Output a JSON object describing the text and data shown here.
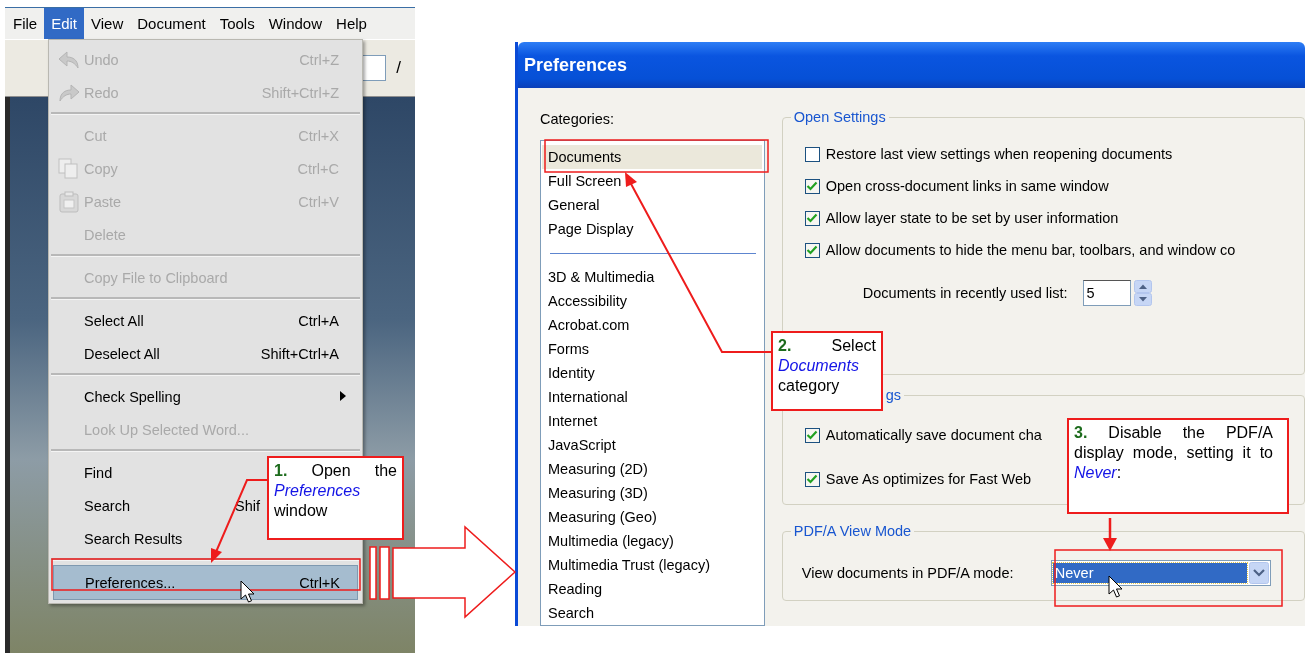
{
  "menu_bar": [
    {
      "label": "File",
      "selected": false
    },
    {
      "label": "Edit",
      "selected": true
    },
    {
      "label": "View",
      "selected": false
    },
    {
      "label": "Document",
      "selected": false
    },
    {
      "label": "Tools",
      "selected": false
    },
    {
      "label": "Window",
      "selected": false
    },
    {
      "label": "Help",
      "selected": false
    }
  ],
  "toolbar": {
    "page_separator": "/"
  },
  "edit_menu": [
    {
      "kind": "item",
      "label": "Undo",
      "shortcut": "Ctrl+Z",
      "disabled": true,
      "selected": false
    },
    {
      "kind": "item",
      "label": "Redo",
      "shortcut": "Shift+Ctrl+Z",
      "disabled": true,
      "selected": false
    },
    {
      "kind": "separator"
    },
    {
      "kind": "item",
      "label": "Cut",
      "shortcut": "Ctrl+X",
      "disabled": true,
      "selected": false
    },
    {
      "kind": "item",
      "label": "Copy",
      "shortcut": "Ctrl+C",
      "disabled": true,
      "selected": false
    },
    {
      "kind": "item",
      "label": "Paste",
      "shortcut": "Ctrl+V",
      "disabled": true,
      "selected": false
    },
    {
      "kind": "item",
      "label": "Delete",
      "disabled": true,
      "selected": false
    },
    {
      "kind": "separator"
    },
    {
      "kind": "item",
      "label": "Copy File to Clipboard",
      "disabled": true,
      "selected": false
    },
    {
      "kind": "separator"
    },
    {
      "kind": "item",
      "label": "Select All",
      "shortcut": "Ctrl+A",
      "disabled": false,
      "selected": false
    },
    {
      "kind": "item",
      "label": "Deselect All",
      "shortcut": "Shift+Ctrl+A",
      "disabled": false,
      "selected": false
    },
    {
      "kind": "separator"
    },
    {
      "kind": "submenu",
      "label": "Check Spelling",
      "disabled": false,
      "selected": false
    },
    {
      "kind": "item",
      "label": "Look Up Selected Word...",
      "disabled": true,
      "selected": false
    },
    {
      "kind": "separator"
    },
    {
      "kind": "item",
      "label": "Find",
      "disabled": false,
      "selected": false
    },
    {
      "kind": "item",
      "label": "Search",
      "shortcut": "Shif",
      "disabled": false,
      "selected": false
    },
    {
      "kind": "item",
      "label": "Search Results",
      "disabled": false,
      "selected": false
    },
    {
      "kind": "separator"
    },
    {
      "kind": "item",
      "label": "Preferences...",
      "shortcut": "Ctrl+K",
      "disabled": false,
      "selected": true
    }
  ],
  "preferences": {
    "title": "Preferences",
    "categories_label": "Categories:",
    "categories": [
      {
        "kind": "item",
        "label": "Documents",
        "selected": true
      },
      {
        "kind": "item",
        "label": "Full Screen",
        "selected": false
      },
      {
        "kind": "item",
        "label": "General",
        "selected": false
      },
      {
        "kind": "item",
        "label": "Page Display",
        "selected": false
      },
      {
        "kind": "separator"
      },
      {
        "kind": "item",
        "label": "3D & Multimedia",
        "selected": false
      },
      {
        "kind": "item",
        "label": "Accessibility",
        "selected": false
      },
      {
        "kind": "item",
        "label": "Acrobat.com",
        "selected": false
      },
      {
        "kind": "item",
        "label": "Forms",
        "selected": false
      },
      {
        "kind": "item",
        "label": "Identity",
        "selected": false
      },
      {
        "kind": "item",
        "label": "International",
        "selected": false
      },
      {
        "kind": "item",
        "label": "Internet",
        "selected": false
      },
      {
        "kind": "item",
        "label": "JavaScript",
        "selected": false
      },
      {
        "kind": "item",
        "label": "Measuring (2D)",
        "selected": false
      },
      {
        "kind": "item",
        "label": "Measuring (3D)",
        "selected": false
      },
      {
        "kind": "item",
        "label": "Measuring (Geo)",
        "selected": false
      },
      {
        "kind": "item",
        "label": "Multimedia (legacy)",
        "selected": false
      },
      {
        "kind": "item",
        "label": "Multimedia Trust (legacy)",
        "selected": false
      },
      {
        "kind": "item",
        "label": "Reading",
        "selected": false
      },
      {
        "kind": "item",
        "label": "Search",
        "selected": false
      }
    ],
    "open_settings": {
      "title": "Open Settings",
      "options": [
        {
          "label": "Restore last view settings when reopening documents",
          "checked": false
        },
        {
          "label": "Open cross-document links in same window",
          "checked": true
        },
        {
          "label": "Allow layer state to be set by user information",
          "checked": true
        },
        {
          "label": "Allow documents to hide the menu bar, toolbars, and window co",
          "checked": true
        }
      ],
      "recent_list": {
        "label": "Documents in recently used list:",
        "value": "5"
      }
    },
    "save_settings": {
      "title": "gs",
      "options": [
        {
          "label": "Automatically save document cha",
          "checked": true
        },
        {
          "label": "Save As optimizes for Fast Web",
          "checked": true
        }
      ]
    },
    "pdfa_view_mode": {
      "title": "PDF/A View Mode",
      "label": "View documents in PDF/A mode:",
      "value": "Never"
    }
  },
  "callouts": [
    {
      "text": "**1.** Open the *Preferences* window"
    },
    {
      "text": "**2.** Select *Documents* category"
    },
    {
      "text": "**3.** Disable the PDF/A display mode, setting it to *Never*:"
    }
  ]
}
